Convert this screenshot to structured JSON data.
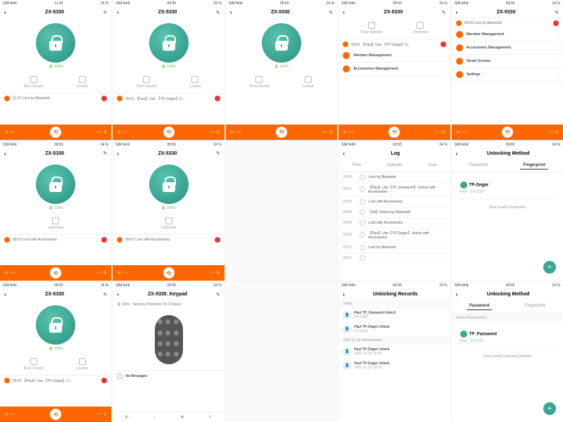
{
  "status": {
    "carrier": "SIM fehlt",
    "wifi": "◦",
    "batt": "24 %"
  },
  "device": "ZX-5330",
  "battery": "100%",
  "doorClosed": "Door Closed",
  "doorOpened": "Door Opened",
  "locked": "Locked",
  "unlocked": "Unlocked",
  "phones": {
    "p1": {
      "time": "11:30",
      "event": "11:27  Lock by Bluetooth"
    },
    "p2": {
      "time": "09:50",
      "event": "09:51  【Paul】Use 【TP-Zeiger】U..."
    },
    "p3": {
      "time": "09:53",
      "event": ""
    },
    "p6": {
      "time": "09:50",
      "event": "09:07  Lock with Accessories"
    },
    "p7": {
      "time": "09:50",
      "event": "09:07  Lock with Accessories"
    },
    "p11": {
      "time": "09:52",
      "event": "09:51  【Paul】Use 【TP-Zeiger】U..."
    }
  },
  "menu4": {
    "time": "09:53",
    "event": "09:51  【Paul】Use 【TP-Zeiger】U...",
    "items": [
      "Member Management",
      "Accessories Management"
    ]
  },
  "menu5": {
    "time": "09:09",
    "event": "09:09  Lock by Bluetooth",
    "items": [
      "Member Management",
      "Accessories Management",
      "Smart Scenes",
      "Settings"
    ]
  },
  "log": {
    "title": "Log",
    "time": "09:55",
    "tabs": [
      "Time",
      "Operate",
      "User"
    ],
    "rows": [
      {
        "t": "09:54",
        "d": "Lock by Bluetooth"
      },
      {
        "t": "09:51",
        "d": "【Paul】Use【TP_Password】Unlock with Accessories"
      },
      {
        "t": "09:49",
        "d": "Lock with Accessories"
      },
      {
        "t": "09:49",
        "d": "【Va】Unlock by Bluetooth"
      },
      {
        "t": "09:49",
        "d": "Lock with Accessories"
      },
      {
        "t": "09:10",
        "d": "【Paul】Use【TP-Zeiger】Unlock with Accessories"
      },
      {
        "t": "09:12",
        "d": "Lock by Bluetooth"
      },
      {
        "t": "09:12",
        "d": ""
      }
    ]
  },
  "unlock": {
    "title": "Unlocking Method",
    "time": "09:09",
    "tabs": [
      "Password",
      "Fingerprint"
    ],
    "fp": {
      "name": "TP-Zeiger",
      "sub": "Paul · ZX-5330"
    },
    "link": "View Invalid Fingerprint"
  },
  "keypad": {
    "title": "ZX-5330_Keypad",
    "time": "09:55",
    "batt": "94%",
    "security": "Security Protection for 2 Day(s)",
    "noMsg": "No Messages"
  },
  "records": {
    "title": "Unlocking Records",
    "time": "09:55",
    "today": "Today",
    "rows": [
      {
        "n": "Paul TP_Password Unlock",
        "s": "ZX-5330"
      },
      {
        "n": "Paul TP-Zeiger Unlock",
        "s": "ZX-5330"
      }
    ],
    "yesterday": "2022-11-16 (Wednesday)",
    "rows2": [
      {
        "n": "Paul TP-Zeiger Unlock",
        "s": "2022-11-16 18:25"
      },
      {
        "n": "Paul TP-Zeiger Unlock",
        "s": "2022-11-16 18:25"
      }
    ]
  },
  "unlockPw": {
    "title": "Unlocking Method",
    "time": "09:09",
    "section": "Online Password(1)",
    "pw": {
      "name": "TP_Password",
      "sub": "Paul · ZX-5330"
    },
    "link": "View Invalid Unlocking Method"
  }
}
